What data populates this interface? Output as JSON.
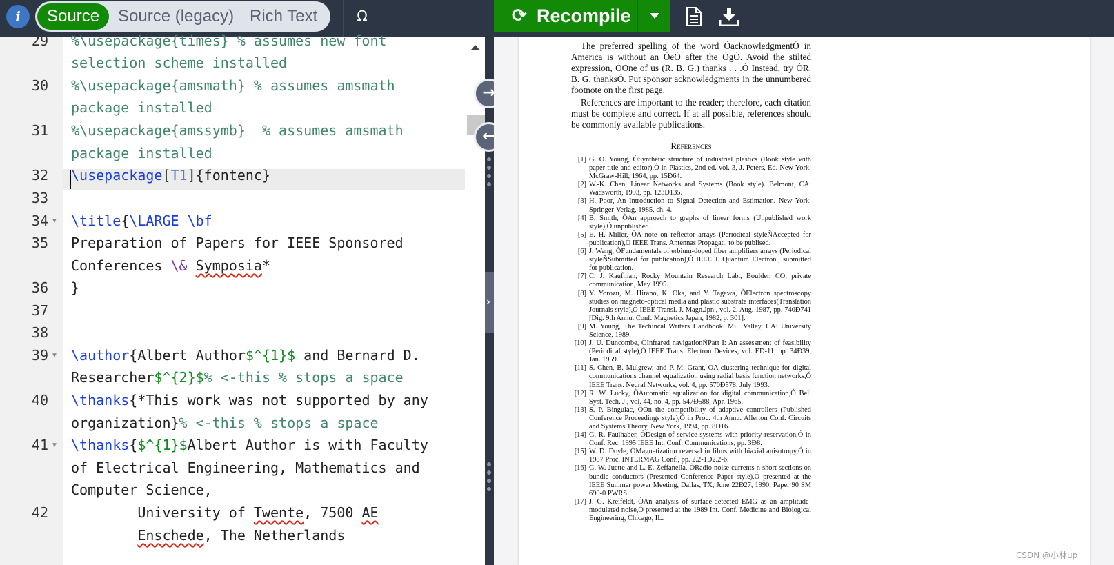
{
  "toolbar": {
    "info_glyph": "i",
    "modes": {
      "source": "Source",
      "legacy": "Source (legacy)",
      "rich": "Rich Text"
    },
    "symbol_glyph": "Ω",
    "recompile_glyph": "⟳",
    "recompile_label": "Recompile",
    "colors": {
      "bar": "#2c3645",
      "accent_green": "#138a07",
      "pill": "#dfe3ea"
    }
  },
  "editor": {
    "line_numbers": [
      "29",
      "30",
      "31",
      "32",
      "33",
      "34",
      "35",
      "36",
      "37",
      "38",
      "39",
      "40",
      "41",
      "42"
    ],
    "lines": {
      "l29a": "%\\usepackage{times} % assumes new font",
      "l29b": "selection scheme installed",
      "l30a": "%\\usepackage{amsmath} % assumes amsmath",
      "l30b": "package installed",
      "l31a": "%\\usepackage{amssymb}  % assumes amsmath",
      "l31b": "package installed",
      "l32_cmd": "\\usepackage",
      "l32_b1": "[",
      "l32_opt": "T1",
      "l32_b2": "]{fontenc}",
      "l34_cmd": "\\title",
      "l34_brace": "{",
      "l34_rest": "\\LARGE \\bf",
      "l35a": "Preparation of Papers for IEEE Sponsored",
      "l35b_1": "Conferences ",
      "l35b_amp": "\\&",
      "l35b_sp": " ",
      "l35b_word": "Symposia",
      "l35b_star": "*",
      "l36": "}",
      "l39_cmd": "\\author",
      "l39_t1": "{Albert Author",
      "l39_m1": "$^{1}$",
      "l39_t2": " and Bernard D.",
      "l39b_t": "Researcher",
      "l39b_m": "$^{2}$",
      "l39b_c": "% <-this % stops a space",
      "l40_cmd": "\\thanks",
      "l40_t": "{*This work was not supported by any",
      "l40b_t": "organization}",
      "l40b_c": "% <-this % stops a space",
      "l41_cmd": "\\thanks",
      "l41_b": "{",
      "l41_m": "$^{1}$",
      "l41_t": "Albert Author is with Faculty",
      "l41b": "of Electrical Engineering, Mathematics and",
      "l41c": "Computer Science,",
      "l42a_pre": "        University of ",
      "l42a_sp": "Twente",
      "l42a_mid": ", 7500 ",
      "l42a_ae": "AE",
      "l42b_pre": "        ",
      "l42b_sp": "Enschede",
      "l42b_post": ", The Netherlands"
    }
  },
  "pdf": {
    "para1": "The preferred spelling of the word ÒacknowledgmentÓ in America is without an ÒeÓ after the ÒgÓ. Avoid the stilted expression, ÒOne of us (R. B. G.) thanks . . .Ó Instead, try ÒR. B. G. thanksÓ. Put sponsor acknowledgments in the unnumbered footnote on the first page.",
    "para2": "References are important to the reader; therefore, each citation must be complete and correct. If at all possible, references should be commonly available publications.",
    "references_heading": "References",
    "references": [
      {
        "num": "[1]",
        "text": "G. O. Young, ÒSynthetic structure of industrial plastics (Book style with paper title and editor),Ó in Plastics, 2nd ed. vol. 3, J. Peters, Ed. New York: McGraw-Hill, 1964, pp. 15Ð64."
      },
      {
        "num": "[2]",
        "text": "W.-K. Chen, Linear Networks and Systems (Book style). Belmont, CA: Wadsworth, 1993, pp. 123Ð135."
      },
      {
        "num": "[3]",
        "text": "H. Poor, An Introduction to Signal Detection and Estimation. New York: Springer-Verlag, 1985, ch. 4."
      },
      {
        "num": "[4]",
        "text": "B. Smith, ÒAn approach to graphs of linear forms (Unpublished work style),Ó unpublished."
      },
      {
        "num": "[5]",
        "text": "E. H. Miller, ÒA note on reflector arrays (Periodical styleÑAccepted for publication),Ó IEEE Trans. Antennas Propagat., to be publised."
      },
      {
        "num": "[6]",
        "text": "J. Wang, ÒFundamentals of erbium-doped fiber amplifiers arrays (Periodical styleÑSubmitted for publication),Ó IEEE J. Quantum Electron., submitted for publication."
      },
      {
        "num": "[7]",
        "text": "C. J. Kaufman, Rocky Mountain Research Lab., Boulder, CO, private communication, May 1995."
      },
      {
        "num": "[8]",
        "text": "Y. Yorozu, M. Hirano, K. Oka, and Y. Tagawa, ÒElectron spectroscopy studies on magneto-optical media and plastic substrate interfaces(Translation Journals style),Ó IEEE Transl. J. Magn.Jpn., vol. 2, Aug. 1987, pp. 740Ð741 [Dig. 9th Annu. Conf. Magnetics Japan, 1982, p. 301]."
      },
      {
        "num": "[9]",
        "text": "M. Young, The Techincal Writers Handbook. Mill Valley, CA: University Science, 1989."
      },
      {
        "num": "[10]",
        "text": "J. U. Duncombe, ÒInfrared navigationÑPart I: An assessment of feasibility (Periodical style),Ó IEEE Trans. Electron Devices, vol. ED-11, pp. 34Ð39, Jan. 1959."
      },
      {
        "num": "[11]",
        "text": "S. Chen, B. Mulgrew, and P. M. Grant, ÒA clustering technique for digital communications channel equalization using radial basis function networks,Ó IEEE Trans. Neural Networks, vol. 4, pp. 570Ð578, July 1993."
      },
      {
        "num": "[12]",
        "text": "R. W. Lucky, ÒAutomatic equalization for digital communication,Ó Bell Syst. Tech. J., vol. 44, no. 4, pp. 547Ð588, Apr. 1965."
      },
      {
        "num": "[13]",
        "text": "S. P. Bingulac, ÒOn the compatibility of adaptive controllers (Published Conference Proceedings style),Ó in Proc. 4th Annu. Allerton Conf. Circuits and Systems Theory, New York, 1994, pp. 8Ð16."
      },
      {
        "num": "[14]",
        "text": "G. R. Faulhaber, ÒDesign of service systems with priority reservation,Ó in Conf. Rec. 1995 IEEE Int. Conf. Communications, pp. 3Ð8."
      },
      {
        "num": "[15]",
        "text": "W. D. Doyle, ÒMagnetization reversal in films with biaxial anisotropy,Ó in 1987 Proc. INTERMAG Conf., pp. 2.2-1Ð2.2-6."
      },
      {
        "num": "[16]",
        "text": "G. W. Juette and L. E. Zeffanella, ÒRadio noise currents n short sections on bundle conductors (Presented Conference Paper style),Ó presented at the IEEE Summer power Meeting, Dallas, TX, June 22Ð27, 1990, Paper 90 SM 690-0 PWRS."
      },
      {
        "num": "[17]",
        "text": "J. G. Kreifeldt, ÒAn analysis of surface-detected EMG as an amplitude-modulated noise,Ó presented at the 1989 Int. Conf. Medicine and Biological Engineering, Chicago, IL."
      }
    ],
    "watermark": "CSDN @小林up"
  }
}
